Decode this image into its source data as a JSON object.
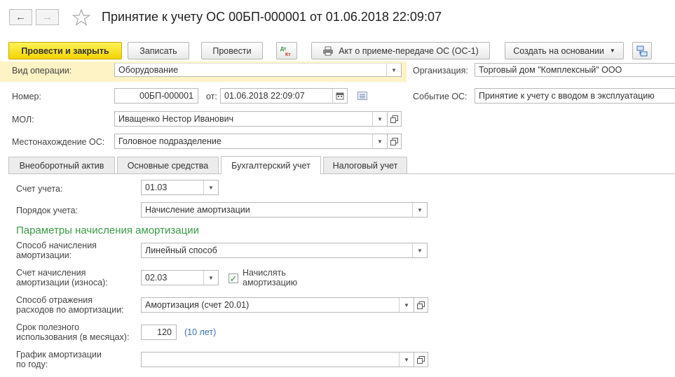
{
  "header": {
    "back_label": "←",
    "forward_label": "→",
    "title": "Принятие к учету ОС 00БП-000001 от 01.06.2018 22:09:07"
  },
  "toolbar": {
    "post_close": "Провести и закрыть",
    "save": "Записать",
    "post": "Провести",
    "dt_kt": "Дт Кт",
    "print_act": "Акт о приеме-передаче ОС (ОС-1)",
    "create_based": "Создать на основании"
  },
  "form": {
    "operation_label": "Вид операции:",
    "operation_value": "Оборудование",
    "org_label": "Организация:",
    "org_value": "Торговый дом \"Комплексный\" ООО",
    "number_label": "Номер:",
    "number_value": "00БП-000001",
    "from_label": "от:",
    "date_value": "01.06.2018 22:09:07",
    "event_label": "Событие ОС:",
    "event_value": "Принятие к учету с вводом в эксплуатацию",
    "mol_label": "МОЛ:",
    "mol_value": "Иващенко Нестор Иванович",
    "location_label": "Местонахождение ОС:",
    "location_value": "Головное подразделение"
  },
  "tabs": [
    {
      "label": "Внеоборотный актив"
    },
    {
      "label": "Основные средства"
    },
    {
      "label": "Бухгалтерский учет",
      "active": true
    },
    {
      "label": "Налоговый учет"
    }
  ],
  "accounting": {
    "account_label": "Счет учета:",
    "account_value": "01.03",
    "order_label": "Порядок учета:",
    "order_value": "Начисление амортизации",
    "section_title": "Параметры начисления амортизации",
    "method_label_1": "Способ начисления",
    "method_label_2": "амортизации:",
    "method_value": "Линейный способ",
    "depr_account_label_1": "Счет начисления",
    "depr_account_label_2": "амортизации (износа):",
    "depr_account_value": "02.03",
    "charge_depr_label_1": "Начислять",
    "charge_depr_label_2": "амортизацию",
    "charge_depr_checked": true,
    "reflect_label_1": "Способ отражения",
    "reflect_label_2": "расходов по амортизации:",
    "reflect_value": "Амортизация (счет 20.01)",
    "life_label_1": "Срок полезного",
    "life_label_2": "использования (в месяцах):",
    "life_value": "120",
    "life_years": "(10 лет)",
    "schedule_label_1": "График амортизации",
    "schedule_label_2": "по году:",
    "schedule_value": ""
  },
  "colors": {
    "primary_button": "#f2d400",
    "section_title": "#3a9a47",
    "link": "#3a73b5",
    "highlight_row": "#fdf3c4"
  }
}
